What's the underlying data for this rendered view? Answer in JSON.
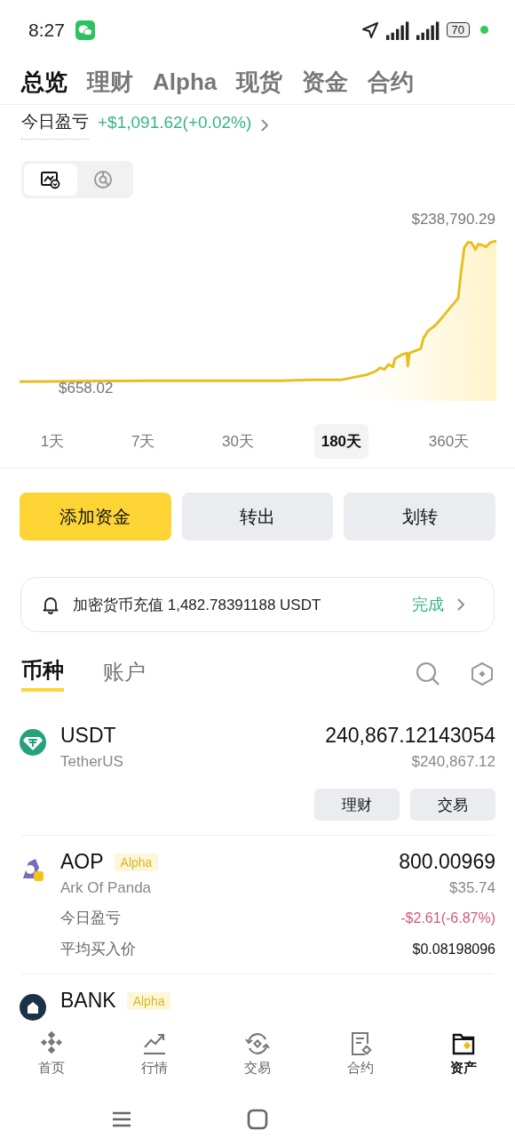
{
  "status_bar": {
    "time": "8:27",
    "battery": "70"
  },
  "tabs": [
    {
      "label": "总览",
      "selected": true
    },
    {
      "label": "理财",
      "selected": false
    },
    {
      "label": "Alpha",
      "selected": false
    },
    {
      "label": "现货",
      "selected": false
    },
    {
      "label": "资金",
      "selected": false
    },
    {
      "label": "合约",
      "selected": false
    }
  ],
  "pnl": {
    "label": "今日盈亏",
    "value": "+$1,091.62(+0.02%)"
  },
  "view_toggle": [
    {
      "kind": "chart",
      "selected": true
    },
    {
      "kind": "pie",
      "selected": false
    }
  ],
  "chart": {
    "max_label": "$238,790.29",
    "min_label": "$658.02"
  },
  "periods": [
    {
      "label": "1天",
      "selected": false
    },
    {
      "label": "7天",
      "selected": false
    },
    {
      "label": "30天",
      "selected": false
    },
    {
      "label": "180天",
      "selected": true
    },
    {
      "label": "360天",
      "selected": false
    }
  ],
  "actions": [
    {
      "label": "添加资金",
      "kind": "primary"
    },
    {
      "label": "转出",
      "kind": "secondary"
    },
    {
      "label": "划转",
      "kind": "secondary"
    }
  ],
  "notice": {
    "text": "加密货币充值 1,482.78391188 USDT",
    "status": "完成"
  },
  "asset_tabs": [
    {
      "label": "币种",
      "selected": true
    },
    {
      "label": "账户",
      "selected": false
    }
  ],
  "assets": [
    {
      "symbol": "USDT",
      "name": "TetherUS",
      "amount": "240,867.12143054",
      "value": "$240,867.12",
      "kind": "tether",
      "buttons": [
        "理财",
        "交易"
      ]
    },
    {
      "symbol": "AOP",
      "tag": "Alpha",
      "name": "Ark Of Panda",
      "amount": "800.00969",
      "value": "$35.74",
      "kind": "panda",
      "details": [
        {
          "label": "今日盈亏",
          "value": "-$2.61(-6.87%)",
          "kind": "loss"
        },
        {
          "label": "平均买入价",
          "value": "$0.08198096",
          "kind": "plain"
        }
      ]
    },
    {
      "symbol": "BANK",
      "tag": "Alpha",
      "kind": "bank"
    }
  ],
  "nav": [
    {
      "label": "首页",
      "kind": "home",
      "selected": false
    },
    {
      "label": "行情",
      "kind": "markets",
      "selected": false
    },
    {
      "label": "交易",
      "kind": "trade",
      "selected": false
    },
    {
      "label": "合约",
      "kind": "futures",
      "selected": false
    },
    {
      "label": "资产",
      "kind": "wallet",
      "selected": true
    }
  ]
}
